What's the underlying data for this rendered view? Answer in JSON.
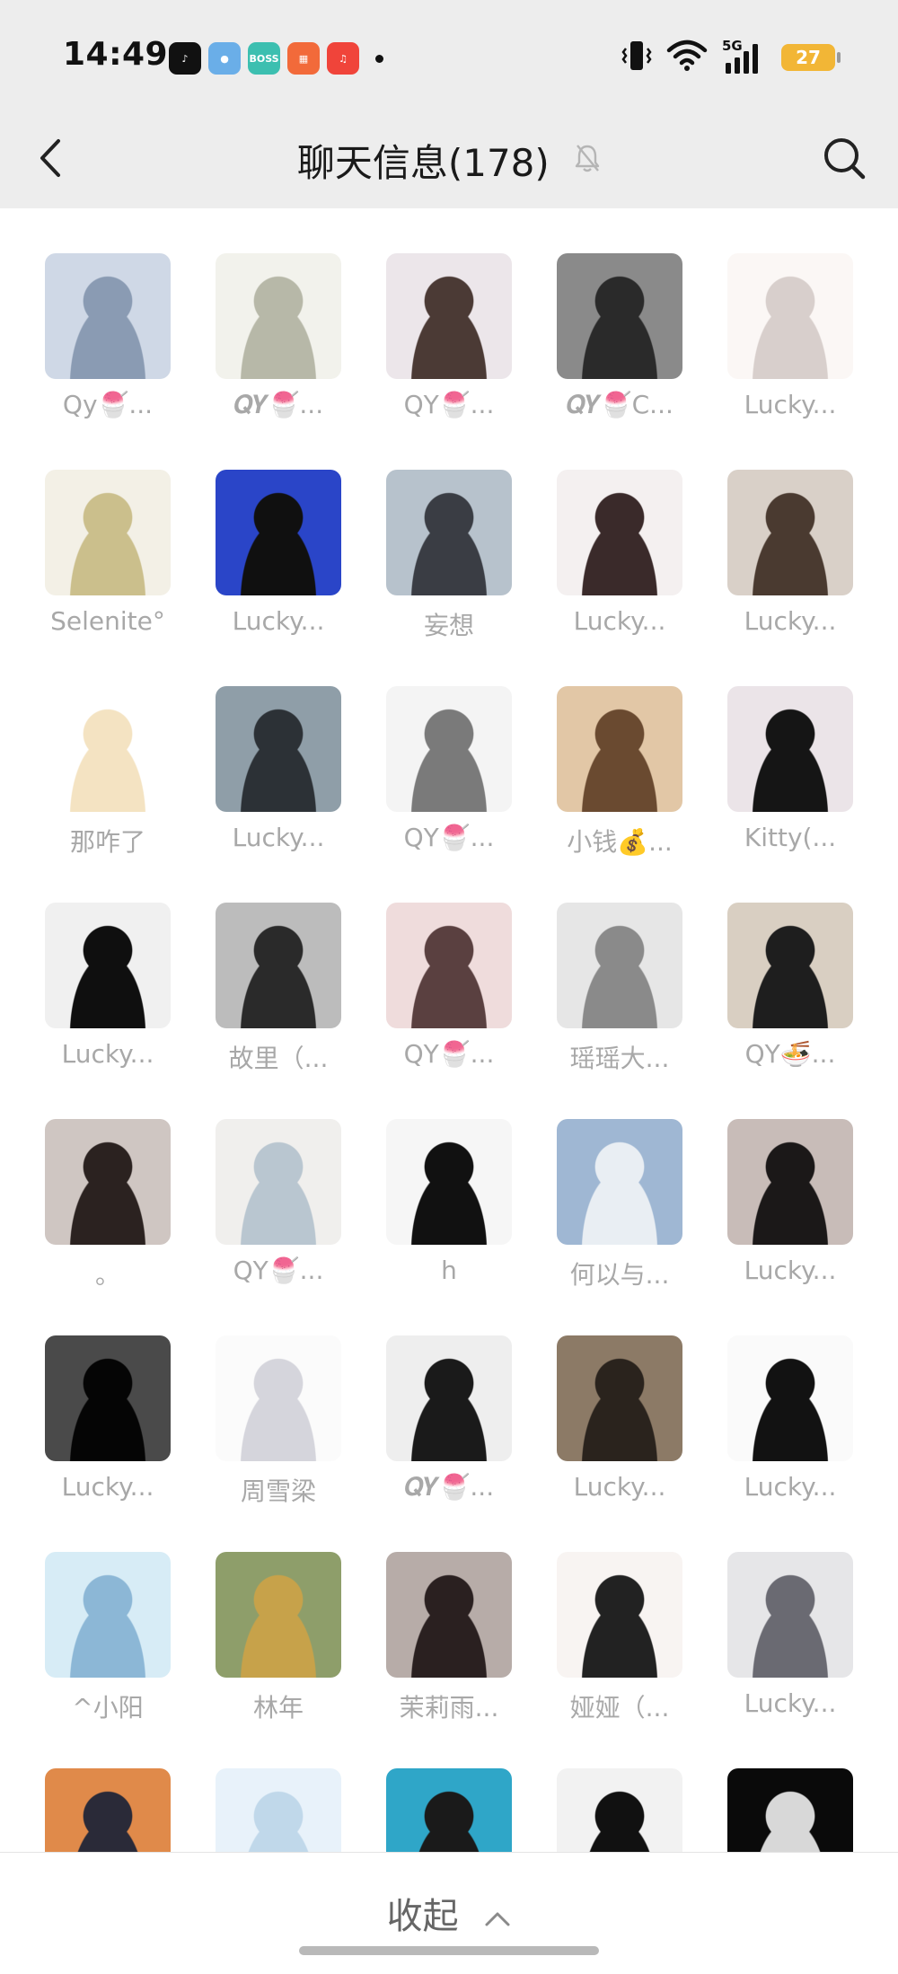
{
  "status_bar": {
    "time": "14:49",
    "notifications": [
      {
        "icon": "tiktok-icon",
        "color": "#111111",
        "text": "♪"
      },
      {
        "icon": "bluebird-app-icon",
        "color": "#6aaee8",
        "text": "●"
      },
      {
        "icon": "boss-zhipin-icon",
        "color": "#3cbfb0",
        "text": "BOSS"
      },
      {
        "icon": "orange-app-icon",
        "color": "#f26a3a",
        "text": "▦"
      },
      {
        "icon": "music-app-icon",
        "color": "#f0443a",
        "text": "♫"
      }
    ],
    "network": "5G",
    "battery": "27"
  },
  "header": {
    "title": "聊天信息(178)"
  },
  "members": [
    {
      "name": "Qy🍧...",
      "c1": "#cfd8e6",
      "c2": "#8a9bb3"
    },
    {
      "name": "𝑸𝒀🍧...",
      "c1": "#f2f2ec",
      "c2": "#b7b8a8"
    },
    {
      "name": "QY🍧...",
      "c1": "#ece6ea",
      "c2": "#4b3a35"
    },
    {
      "name": "𝑸𝒀🍧C...",
      "c1": "#8a8a8a",
      "c2": "#2a2a2a"
    },
    {
      "name": "Lucky...",
      "c1": "#fbf7f5",
      "c2": "#d8cfcc"
    },
    {
      "name": "Selenite°",
      "c1": "#f3f0e6",
      "c2": "#cbbf8c"
    },
    {
      "name": "Lucky...",
      "c1": "#2a45c8",
      "c2": "#101010"
    },
    {
      "name": "妄想",
      "c1": "#b7c2cc",
      "c2": "#3a3d44"
    },
    {
      "name": "Lucky...",
      "c1": "#f4f0f0",
      "c2": "#3a2a2a"
    },
    {
      "name": "Lucky...",
      "c1": "#d9d0c8",
      "c2": "#4a3a30"
    },
    {
      "name": "那咋了",
      "c1": "#ffffff",
      "c2": "#f4e3c2"
    },
    {
      "name": "Lucky...",
      "c1": "#8f9ea8",
      "c2": "#2c3136"
    },
    {
      "name": "QY🍧...",
      "c1": "#f4f4f4",
      "c2": "#7a7a7a"
    },
    {
      "name": "小钱💰...",
      "c1": "#e2c7a6",
      "c2": "#6a4a30"
    },
    {
      "name": "Kitty(...",
      "c1": "#ebe4e8",
      "c2": "#151515"
    },
    {
      "name": "Lucky...",
      "c1": "#f0f0f0",
      "c2": "#0f0f0f"
    },
    {
      "name": "故里（...",
      "c1": "#bcbcbc",
      "c2": "#2a2a2a"
    },
    {
      "name": "QY🍧...",
      "c1": "#efdcdc",
      "c2": "#5a4040"
    },
    {
      "name": "瑶瑶大...",
      "c1": "#e6e6e6",
      "c2": "#8a8a8a"
    },
    {
      "name": "QY🍜...",
      "c1": "#d9cfc2",
      "c2": "#1e1e1e"
    },
    {
      "name": "。",
      "c1": "#cfc6c2",
      "c2": "#2b2220"
    },
    {
      "name": "QY🍧...",
      "c1": "#f0efed",
      "c2": "#b9c6d0"
    },
    {
      "name": "h",
      "c1": "#f6f6f6",
      "c2": "#111111"
    },
    {
      "name": "何以与...",
      "c1": "#9fb7d3",
      "c2": "#e9eef3"
    },
    {
      "name": "Lucky...",
      "c1": "#c8bcb8",
      "c2": "#1b1818"
    },
    {
      "name": "Lucky...",
      "c1": "#4a4a4a",
      "c2": "#050505"
    },
    {
      "name": "周雪梁",
      "c1": "#fbfbfb",
      "c2": "#d5d5dc"
    },
    {
      "name": "𝑸𝒀🍧...",
      "c1": "#eeeeee",
      "c2": "#1a1a1a"
    },
    {
      "name": "Lucky...",
      "c1": "#8c7a66",
      "c2": "#2a231d"
    },
    {
      "name": "Lucky...",
      "c1": "#fafafa",
      "c2": "#121212"
    },
    {
      "name": "^小阳",
      "c1": "#d7ecf6",
      "c2": "#8cb7d6"
    },
    {
      "name": "林年",
      "c1": "#8e9e6a",
      "c2": "#c7a24a"
    },
    {
      "name": "茉莉雨...",
      "c1": "#b7aca8",
      "c2": "#2a2020"
    },
    {
      "name": "娅娅（...",
      "c1": "#f8f4f2",
      "c2": "#222222"
    },
    {
      "name": "Lucky...",
      "c1": "#e6e6e8",
      "c2": "#6a6a72"
    },
    {
      "name": "",
      "c1": "#e08a4a",
      "c2": "#2a2a38"
    },
    {
      "name": "",
      "c1": "#e8f2fa",
      "c2": "#c0d8ea"
    },
    {
      "name": "",
      "c1": "#2fa6c8",
      "c2": "#1a1a1a"
    },
    {
      "name": "",
      "c1": "#f2f2f2",
      "c2": "#111111"
    },
    {
      "name": "",
      "c1": "#0a0a0a",
      "c2": "#d8d8d8"
    }
  ],
  "footer": {
    "collapse_label": "收起"
  }
}
